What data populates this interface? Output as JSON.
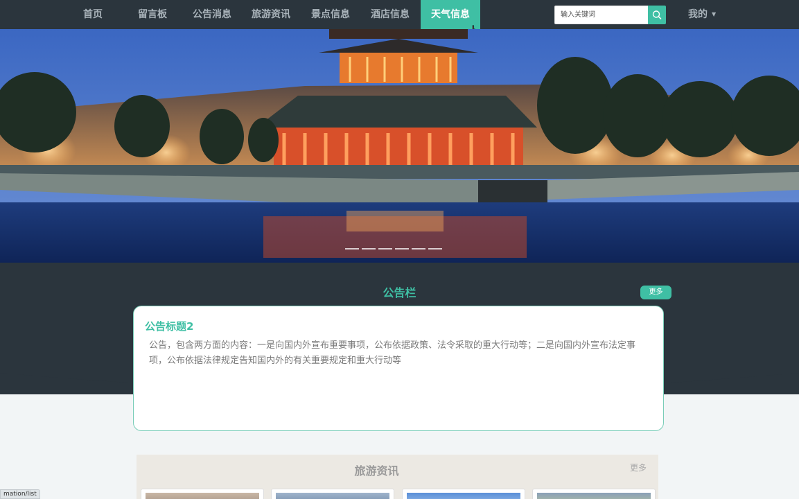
{
  "nav": {
    "items": [
      {
        "label": "首页",
        "active": false
      },
      {
        "label": "留言板",
        "active": false
      },
      {
        "label": "公告消息",
        "active": false
      },
      {
        "label": "旅游资讯",
        "active": false
      },
      {
        "label": "景点信息",
        "active": false
      },
      {
        "label": "酒店信息",
        "active": false
      },
      {
        "label": "天气信息",
        "active": true
      }
    ],
    "search_placeholder": "输入关键词",
    "search_icon": "search-icon",
    "user_label": "我的",
    "user_caret_icon": "caret-down-icon"
  },
  "banner": {
    "image": "forbidden-city-corner-tower-night-photo",
    "slide_count": 6
  },
  "notice": {
    "section_title": "公告栏",
    "more_label": "更多",
    "card_title": "公告标题2",
    "card_text": "公告，包含两方面的内容：一是向国内外宣布重要事项，公布依据政策、法令采取的重大行动等；二是向国内外宣布法定事项，公布依据法律规定告知国内外的有关重要规定和重大行动等"
  },
  "travel": {
    "section_title": "旅游资讯",
    "more_label": "更多",
    "thumbnail_count": 4
  },
  "status_bar": {
    "url": "mation/list"
  },
  "colors": {
    "accent": "#3fbfa4",
    "nav_bg": "#2b353d",
    "page_bg": "#f2f5f6"
  }
}
